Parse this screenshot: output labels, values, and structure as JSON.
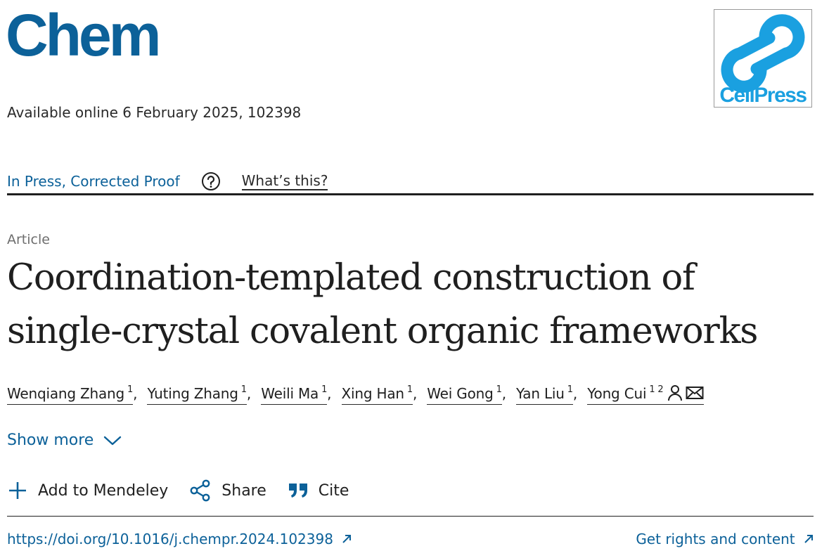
{
  "header": {
    "journal_title": "Chem",
    "publisher_logo_text": "CellPress",
    "availability": "Available online 6 February 2025, 102398"
  },
  "status": {
    "label": "In Press, Corrected Proof",
    "help_icon": "question-circle-icon",
    "whats_this": "What’s this?"
  },
  "article": {
    "type": "Article",
    "title_line1": "Coordination-templated construction of",
    "title_line2": "single-crystal covalent organic frameworks"
  },
  "authors": [
    {
      "name": "Wenqiang Zhang",
      "affiliations": "1"
    },
    {
      "name": "Yuting Zhang",
      "affiliations": "1"
    },
    {
      "name": "Weili Ma",
      "affiliations": "1"
    },
    {
      "name": "Xing Han",
      "affiliations": "1"
    },
    {
      "name": "Wei Gong",
      "affiliations": "1"
    },
    {
      "name": "Yan Liu",
      "affiliations": "1"
    },
    {
      "name": "Yong Cui",
      "affiliations": "1 2",
      "icons": [
        "person-icon",
        "envelope-icon"
      ]
    }
  ],
  "author_separator": ",",
  "show_more": {
    "label": "Show more",
    "icon": "chevron-down-icon"
  },
  "actions": [
    {
      "label": "Add to Mendeley",
      "icon": "plus-icon"
    },
    {
      "label": "Share",
      "icon": "share-icon"
    },
    {
      "label": "Cite",
      "icon": "quote-icon"
    }
  ],
  "links": {
    "doi": "https://doi.org/10.1016/j.chempr.2024.102398",
    "rights": "Get rights and content",
    "external_icon": "external-arrow-icon"
  },
  "colors": {
    "brand_blue": "#0c6199",
    "cellpress_blue": "#1aa0e0",
    "text": "#1f1f1f",
    "muted": "#6e6e6e"
  }
}
